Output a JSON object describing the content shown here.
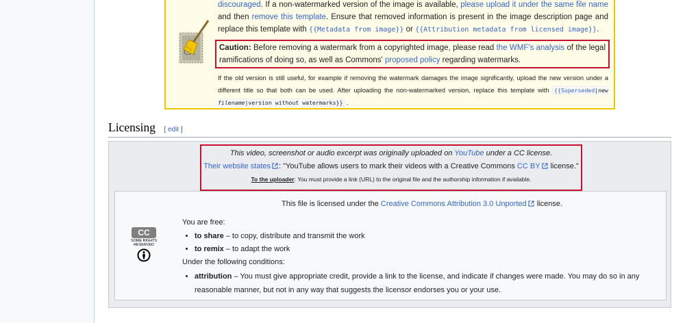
{
  "watermark_notice": {
    "p1_link_discouraged": "discouraged",
    "p1_t1": ". If a non-watermarked version of the image is available, ",
    "p1_link_upload": "please upload it under the same file name",
    "p1_t2": " and then ",
    "p1_link_remove": "remove this template",
    "p1_t3": ". Ensure that removed information is present in the image description page and replace this template with ",
    "p1_code1": "{{Metadata from image}}",
    "p1_t4": " or ",
    "p1_code2": "{{Attribution metadata from licensed image}}",
    "p1_t5": ".",
    "caution_label": "Caution:",
    "caution_t1": " Before removing a watermark from a copyrighted image, please read ",
    "caution_link_wmf": "the WMF's analysis",
    "caution_t2": " of the legal ramifications of doing so, as well as Commons' ",
    "caution_link_policy": "proposed policy",
    "caution_t3": " regarding watermarks.",
    "small_text": "If the old version is still useful, for example if removing the watermark damages the image significantly, upload the new version under a different title so that both can be used. After uploading the non-watermarked version, replace this template with ",
    "small_code_superseded": "{{Superseded",
    "small_code_sep1": "|",
    "small_code_new": "new filename",
    "small_code_sep2": "|version without watermarks}}",
    "small_end": "."
  },
  "section": {
    "title": "Licensing",
    "edit_open": "[ ",
    "edit_label": "edit",
    "edit_close": " ]"
  },
  "youtube_notice": {
    "l1_t1": "This video, screenshot or audio excerpt was originally uploaded on ",
    "l1_link": "YouTube",
    "l1_t2": " under a CC license.",
    "l2_link": "Their website states",
    "l2_t1": ": \"YouTube allows users to mark their videos with a Creative Commons ",
    "l2_link_ccby": "CC BY",
    "l2_t2": " license.\"",
    "l3_label": "To the uploader",
    "l3_text": ": You must provide a link (URL) to the original file and the authorship information if available."
  },
  "cc_license": {
    "badge": "CC",
    "some_rights": "SOME RIGHTS RESERVED",
    "title_t1": "This file is licensed under the ",
    "title_link": "Creative Commons Attribution 3.0 Unported",
    "title_t2": " license.",
    "free_label": "You are free:",
    "share_term": "to share",
    "share_desc": " – to copy, distribute and transmit the work",
    "remix_term": "to remix",
    "remix_desc": " – to adapt the work",
    "conditions_label": "Under the following conditions:",
    "attribution_term": "attribution",
    "attribution_desc": " – You must give appropriate credit, provide a link to the license, and indicate if changes were made. You may do so in any reasonable manner, but not in any way that suggests the licensor endorses you or your use."
  },
  "colors": {
    "link": "#3366cc",
    "highlight_border": "#c8102e",
    "notice_bg": "#fffce8",
    "notice_border": "#f2c500"
  },
  "icons": [
    "broom-icon",
    "external-link-icon",
    "cc-logo-icon",
    "cc-by-icon"
  ]
}
